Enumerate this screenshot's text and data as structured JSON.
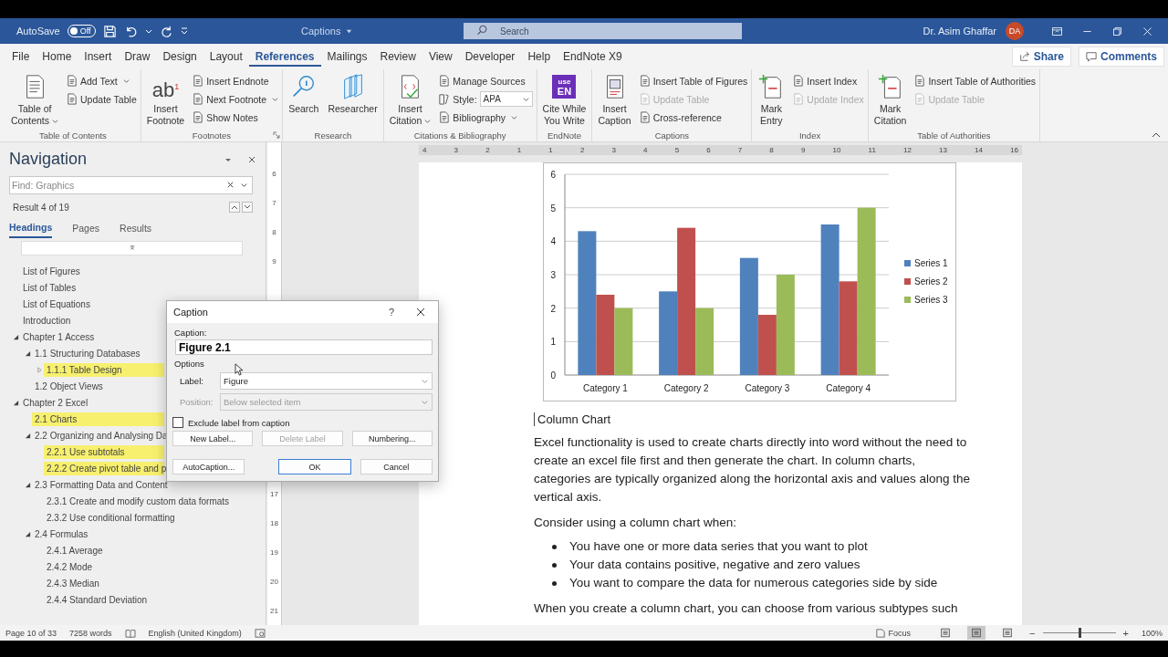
{
  "title_bar": {
    "autosave_label": "AutoSave",
    "autosave_toggle": {
      "label": "Off",
      "on": false
    },
    "document_title": "Captions",
    "search": {
      "placeholder": "Search"
    },
    "user_name": "Dr. Asim Ghaffar",
    "avatar_initials": "DA"
  },
  "ribbon_tabs": [
    {
      "label": "File",
      "selected": false
    },
    {
      "label": "Home",
      "selected": false
    },
    {
      "label": "Insert",
      "selected": false
    },
    {
      "label": "Draw",
      "selected": false
    },
    {
      "label": "Design",
      "selected": false
    },
    {
      "label": "Layout",
      "selected": false
    },
    {
      "label": "References",
      "selected": true
    },
    {
      "label": "Mailings",
      "selected": false
    },
    {
      "label": "Review",
      "selected": false
    },
    {
      "label": "View",
      "selected": false
    },
    {
      "label": "Developer",
      "selected": false
    },
    {
      "label": "Help",
      "selected": false
    },
    {
      "label": "EndNote X9",
      "selected": false
    }
  ],
  "share_button": "Share",
  "comments_button": "Comments",
  "ribbon_groups": [
    {
      "label": "Table of Contents",
      "launcher": false,
      "items": [
        {
          "kind": "large",
          "lines": [
            "Table of",
            "Contents"
          ],
          "dropdown": true,
          "disabled": false
        },
        {
          "kind": "small",
          "label": "Add Text",
          "dropdown": true,
          "disabled": false
        },
        {
          "kind": "small",
          "label": "Update Table",
          "dropdown": false,
          "disabled": false
        }
      ]
    },
    {
      "label": "Footnotes",
      "launcher": true,
      "items": [
        {
          "kind": "large",
          "lines": [
            "Insert",
            "Footnote"
          ],
          "icon_text": "ab$^{1}$",
          "dropdown": false,
          "disabled": false
        },
        {
          "kind": "small",
          "label": "Insert Endnote",
          "dropdown": false,
          "disabled": false
        },
        {
          "kind": "small",
          "label": "Next Footnote",
          "dropdown": true,
          "disabled": false
        },
        {
          "kind": "small",
          "label": "Show Notes",
          "dropdown": false,
          "disabled": false
        }
      ]
    },
    {
      "label": "Research",
      "launcher": false,
      "items": [
        {
          "kind": "large",
          "lines": [
            "Search"
          ],
          "dropdown": false,
          "disabled": false
        },
        {
          "kind": "large",
          "lines": [
            "Researcher"
          ],
          "dropdown": false,
          "disabled": false
        }
      ]
    },
    {
      "label": "Citations & Bibliography",
      "launcher": false,
      "items": [
        {
          "kind": "large",
          "lines": [
            "Insert",
            "Citation"
          ],
          "dropdown": true,
          "disabled": false
        },
        {
          "kind": "small",
          "label": "Manage Sources",
          "dropdown": false,
          "disabled": false
        },
        {
          "kind": "select",
          "label": "Style:",
          "value": "APA",
          "dropdown": true,
          "disabled": false
        },
        {
          "kind": "small",
          "label": "Bibliography",
          "dropdown": true,
          "disabled": false
        }
      ]
    },
    {
      "label": "EndNote",
      "launcher": false,
      "items": [
        {
          "kind": "large",
          "lines": [
            "Cite While",
            "You Write"
          ],
          "icon_lines": [
            "use",
            "EN"
          ],
          "dropdown": false,
          "disabled": false
        }
      ]
    },
    {
      "label": "Captions",
      "launcher": false,
      "items": [
        {
          "kind": "large",
          "lines": [
            "Insert",
            "Caption"
          ],
          "dropdown": false,
          "disabled": false
        },
        {
          "kind": "small",
          "label": "Insert Table of Figures",
          "dropdown": false,
          "disabled": false
        },
        {
          "kind": "small",
          "label": "Update Table",
          "dropdown": false,
          "disabled": true
        },
        {
          "kind": "small",
          "label": "Cross-reference",
          "dropdown": false,
          "disabled": false
        }
      ]
    },
    {
      "label": "Index",
      "launcher": false,
      "items": [
        {
          "kind": "large",
          "lines": [
            "Mark",
            "Entry"
          ],
          "dropdown": false,
          "disabled": false
        },
        {
          "kind": "small",
          "label": "Insert Index",
          "dropdown": false,
          "disabled": false
        },
        {
          "kind": "small",
          "label": "Update Index",
          "dropdown": false,
          "disabled": true
        }
      ]
    },
    {
      "label": "Table of Authorities",
      "launcher": false,
      "items": [
        {
          "kind": "large",
          "lines": [
            "Mark",
            "Citation"
          ],
          "dropdown": false,
          "disabled": false
        },
        {
          "kind": "small",
          "label": "Insert Table of Authorities",
          "dropdown": false,
          "disabled": false
        },
        {
          "kind": "small",
          "label": "Update Table",
          "dropdown": false,
          "disabled": true
        }
      ]
    }
  ],
  "navigation": {
    "title": "Navigation",
    "search": {
      "placeholder": "Find: Graphics"
    },
    "result": "Result 4 of 19",
    "tabs": [
      {
        "label": "Headings",
        "selected": true
      },
      {
        "label": "Pages",
        "selected": false
      },
      {
        "label": "Results",
        "selected": false
      }
    ],
    "tree": [
      {
        "label": "List of Figures",
        "highlighted": false
      },
      {
        "label": "List of Tables",
        "highlighted": false
      },
      {
        "label": "List of Equations",
        "highlighted": false
      },
      {
        "label": "Introduction",
        "highlighted": false
      },
      {
        "label": "Chapter 1 Access",
        "highlighted": false,
        "expanded": true,
        "children": [
          {
            "label": "1.1 Structuring Databases",
            "highlighted": false,
            "expanded": true,
            "children": [
              {
                "label": "1.1.1 Table Design",
                "highlighted": true,
                "expanded": false
              }
            ]
          },
          {
            "label": "1.2 Object Views",
            "highlighted": false
          }
        ]
      },
      {
        "label": "Chapter 2 Excel",
        "highlighted": false,
        "expanded": true,
        "children": [
          {
            "label": "2.1 Charts",
            "highlighted": true
          },
          {
            "label": "2.2 Organizing and Analysing Da",
            "highlighted": false,
            "expanded": true,
            "children": [
              {
                "label": "2.2.1 Use subtotals",
                "highlighted": true
              },
              {
                "label": "2.2.2 Create pivot table and p",
                "highlighted": true
              }
            ]
          },
          {
            "label": "2.3 Formatting Data and Content",
            "highlighted": false,
            "expanded": true,
            "children": [
              {
                "label": "2.3.1 Create and modify custom data formats",
                "highlighted": false
              },
              {
                "label": "2.3.2 Use conditional formatting",
                "highlighted": false
              }
            ]
          },
          {
            "label": "2.4 Formulas",
            "highlighted": false,
            "expanded": true,
            "children": [
              {
                "label": "2.4.1 Average",
                "highlighted": false
              },
              {
                "label": "2.4.2 Mode",
                "highlighted": false
              },
              {
                "label": "2.4.3 Median",
                "highlighted": false
              },
              {
                "label": "2.4.4 Standard Deviation",
                "highlighted": false
              }
            ]
          }
        ]
      }
    ]
  },
  "horizontal_ruler": [
    "4",
    "3",
    "2",
    "1",
    "1",
    "2",
    "3",
    "4",
    "5",
    "6",
    "7",
    "8",
    "9",
    "10",
    "11",
    "12",
    "13",
    "14",
    "16"
  ],
  "vertical_ruler": {
    "top_labels": [
      "6",
      "7",
      "8",
      "9"
    ],
    "bottom_labels": [
      "17",
      "18",
      "19",
      "20",
      "21"
    ]
  },
  "document": {
    "chart_data": {
      "type": "bar",
      "categories": [
        "Category 1",
        "Category 2",
        "Category 3",
        "Category 4"
      ],
      "series": [
        {
          "name": "Series 1",
          "color": "#4f81bd",
          "values": [
            4.3,
            2.5,
            3.5,
            4.5
          ]
        },
        {
          "name": "Series 2",
          "color": "#c0504d",
          "values": [
            2.4,
            4.4,
            1.8,
            2.8
          ]
        },
        {
          "name": "Series 3",
          "color": "#9bbb59",
          "values": [
            2,
            2,
            3,
            5
          ]
        }
      ],
      "ylim": [
        0,
        6
      ],
      "yticks": [
        0,
        1,
        2,
        3,
        4,
        5,
        6
      ],
      "grid": true,
      "legend": true
    },
    "caption": "Column Chart",
    "paragraph_1": "Excel functionality is used to create charts directly into word without the need to create an excel file first and then generate the chart.  In column charts, categories are typically organized along the horizontal axis and values along the vertical axis.",
    "paragraph_2": "Consider using a column chart when:",
    "bullets": [
      "You have one or more data series that you want to plot",
      "Your data contains positive, negative and zero values",
      "You want to compare the data for numerous categories side by side"
    ],
    "paragraph_3": "When you create a column chart, you can choose from various subtypes such"
  },
  "caption_dialog": {
    "title": "Caption",
    "help": "?",
    "caption_label": "Caption:",
    "caption_value": "Figure 2.1",
    "options_label": "Options",
    "label_field": {
      "label": "Label:",
      "value": "Figure",
      "disabled": false
    },
    "position_field": {
      "label": "Position:",
      "value": "Below selected item",
      "disabled": true
    },
    "exclude_checkbox": {
      "label": "Exclude label from caption",
      "checked": false
    },
    "label_buttons": [
      {
        "label": "New Label...",
        "disabled": false,
        "default": false
      },
      {
        "label": "Delete Label",
        "disabled": true,
        "default": false
      },
      {
        "label": "Numbering...",
        "disabled": false,
        "default": false
      }
    ],
    "action_buttons": [
      {
        "label": "AutoCaption...",
        "disabled": false,
        "default": false
      },
      {
        "label": "OK",
        "disabled": false,
        "default": true
      },
      {
        "label": "Cancel",
        "disabled": false,
        "default": false
      }
    ]
  },
  "status_bar": {
    "page": "Page 10 of 33",
    "words": "7258 words",
    "language": "English (United Kingdom)",
    "focus": "Focus",
    "views": [
      {
        "selected": false
      },
      {
        "selected": true
      },
      {
        "selected": false
      }
    ],
    "zoom_out": "−",
    "zoom_in": "+",
    "zoom": {
      "level": 0.5
    },
    "zoom_percent": "100%"
  }
}
